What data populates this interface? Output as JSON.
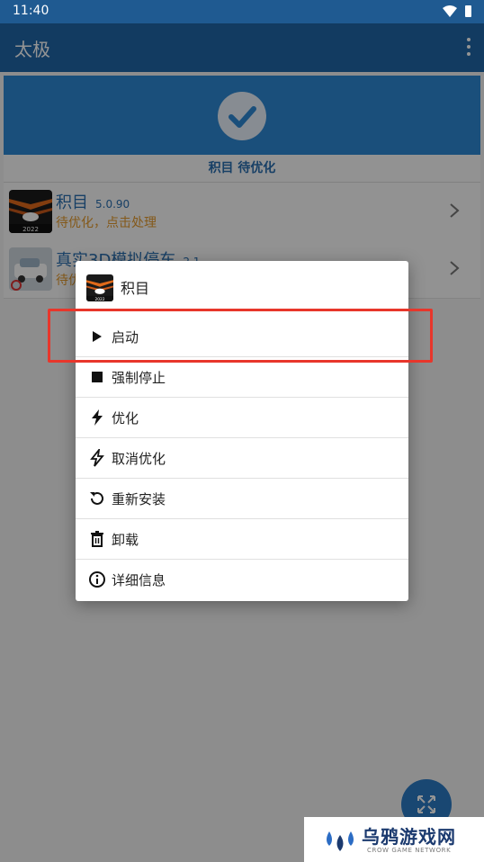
{
  "status_bar": {
    "time": "11:40"
  },
  "app_bar": {
    "title": "太极"
  },
  "banner": {
    "label": "积目 待优化"
  },
  "apps": [
    {
      "name": "积目",
      "version": "5.0.90",
      "status": "待优化，点击处理",
      "icon_label": "2022"
    },
    {
      "name": "真实3D模拟停车",
      "version": "2.1",
      "status": "待优化，点击处理"
    }
  ],
  "dialog": {
    "title": "积目",
    "icon_label": "2022",
    "items": [
      {
        "label": "启动",
        "icon": "play-icon"
      },
      {
        "label": "强制停止",
        "icon": "stop-icon"
      },
      {
        "label": "优化",
        "icon": "bolt-icon"
      },
      {
        "label": "取消优化",
        "icon": "bolt-off-icon"
      },
      {
        "label": "重新安装",
        "icon": "reinstall-icon"
      },
      {
        "label": "卸载",
        "icon": "trash-icon"
      },
      {
        "label": "详细信息",
        "icon": "info-icon"
      }
    ]
  },
  "watermark": {
    "title": "乌鸦游戏网",
    "subtitle": "CROW GAME NETWORK"
  },
  "colors": {
    "primary": "#2067a7",
    "status_bar": "#1f5a91",
    "accent": "#2e88d4",
    "warning_text": "#e49a2d",
    "highlight": "#e8362b"
  }
}
